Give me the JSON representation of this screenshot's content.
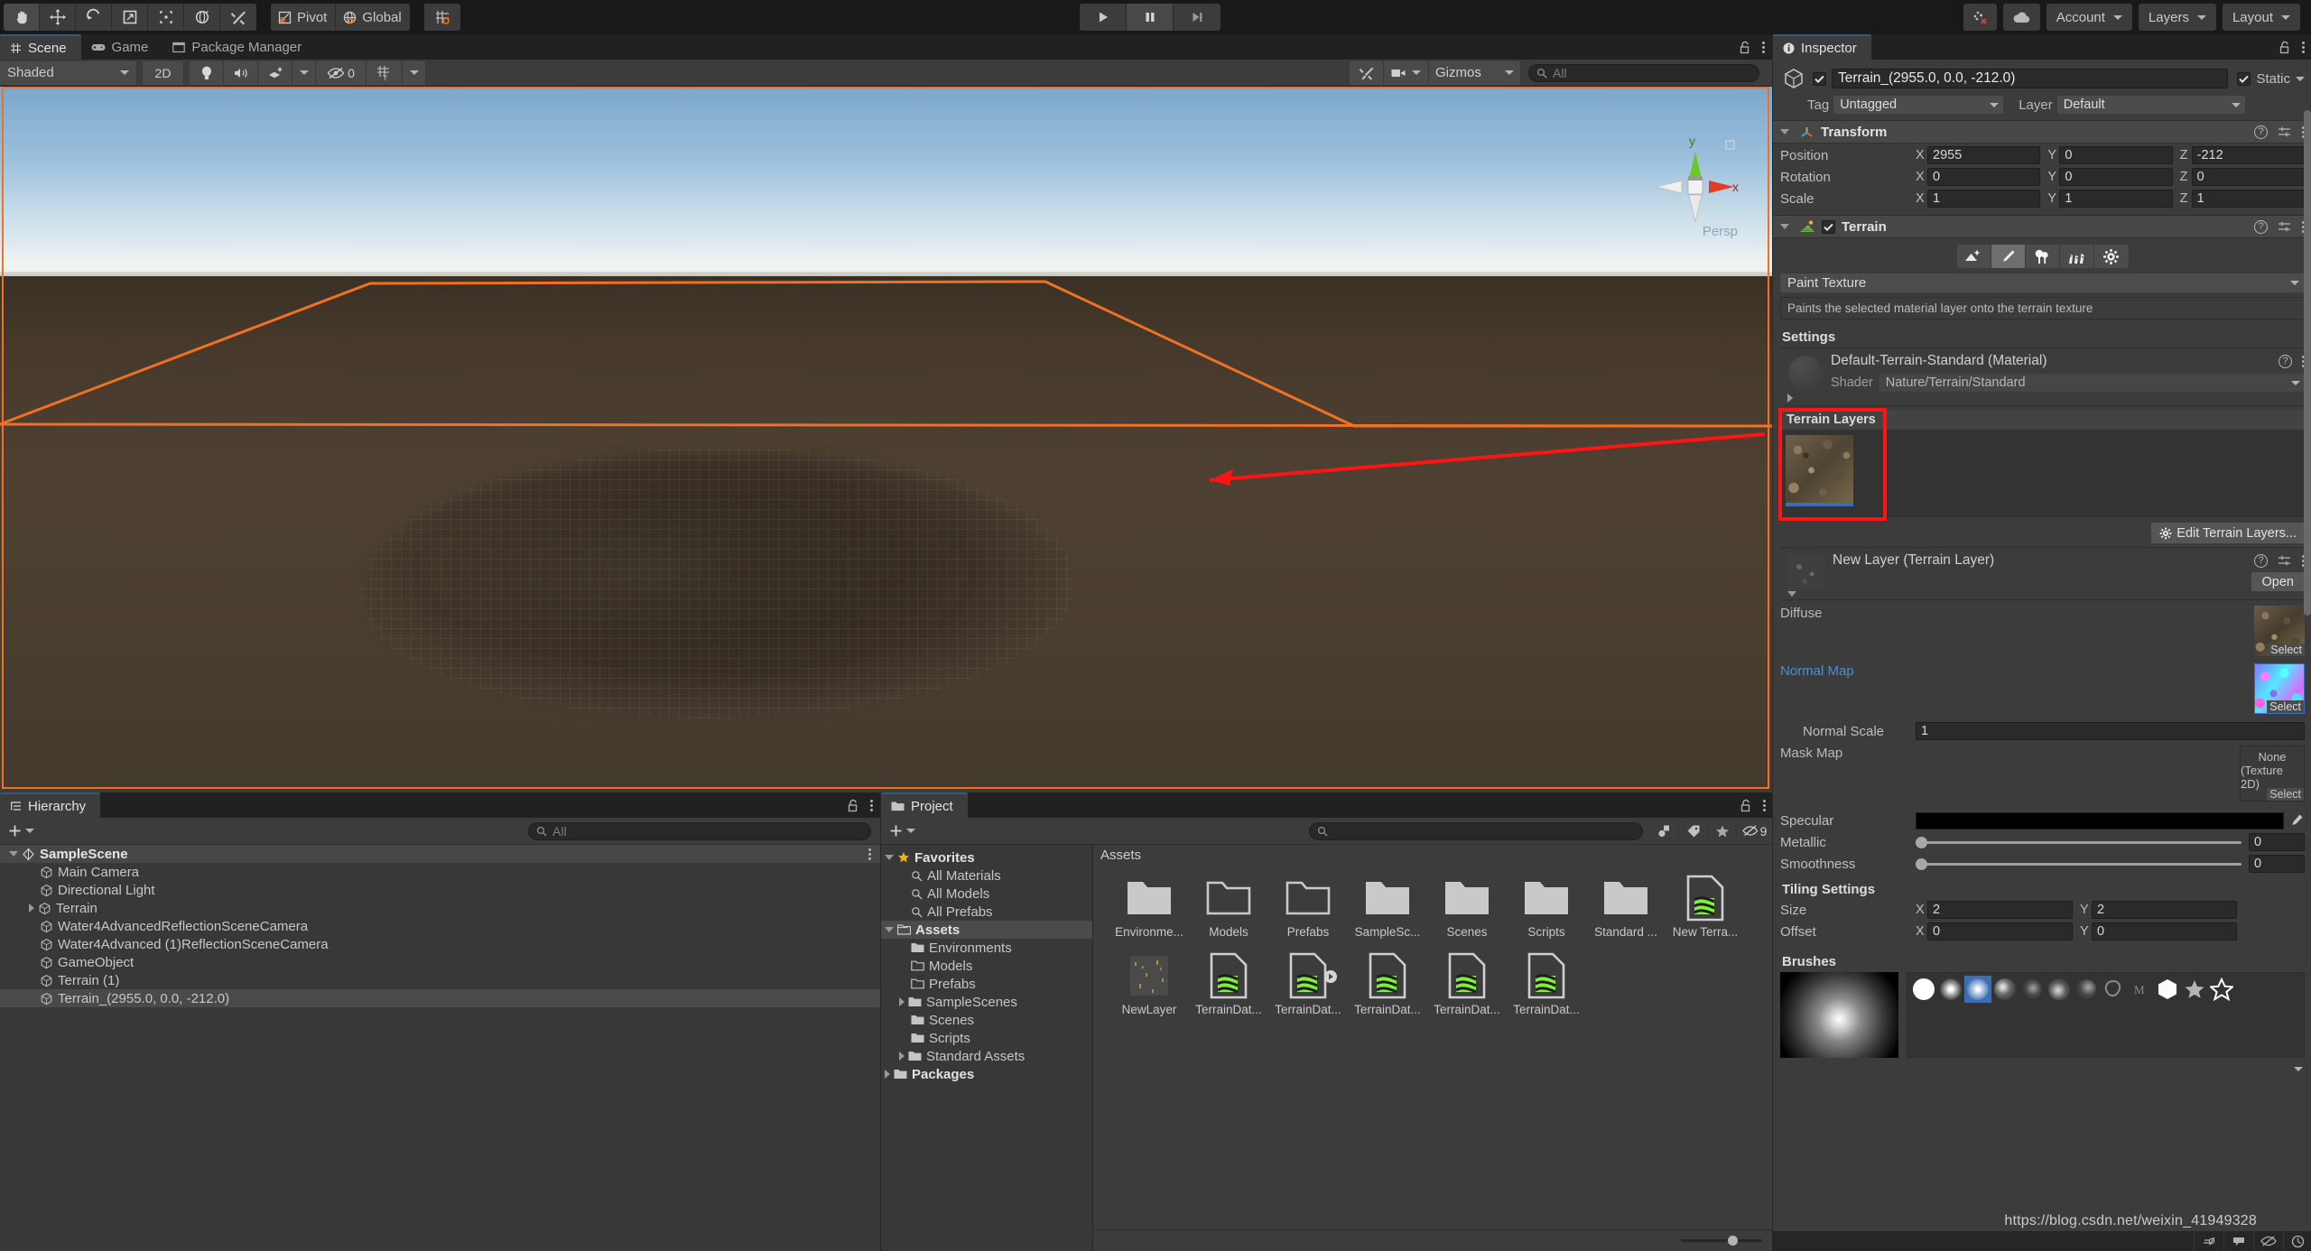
{
  "toolbar": {
    "tools": [
      {
        "name": "hand-tool-icon",
        "label": "Hand"
      },
      {
        "name": "move-tool-icon",
        "label": "Move"
      },
      {
        "name": "rotate-tool-icon",
        "label": "Rotate"
      },
      {
        "name": "scale-tool-icon",
        "label": "Scale"
      },
      {
        "name": "rect-transform-tool-icon",
        "label": "Rect Transform"
      },
      {
        "name": "transform-tool-icon",
        "label": "Transform"
      },
      {
        "name": "custom-editor-tool-icon",
        "label": "Custom Tool"
      }
    ],
    "pivot_label": "Pivot",
    "global_label": "Global",
    "snap_label": "",
    "play_label": "Play",
    "pause_label": "Pause",
    "step_label": "Step",
    "collab_label": "",
    "cloud_label": "",
    "account_label": "Account",
    "layers_label": "Layers",
    "layout_label": "Layout"
  },
  "scene": {
    "tabs": [
      {
        "label": "Scene",
        "icon": "grid-icon",
        "active": true
      },
      {
        "label": "Game",
        "icon": "gamepad-icon",
        "active": false
      },
      {
        "label": "Package Manager",
        "icon": "package-icon",
        "active": false
      }
    ],
    "draw_mode": "Shaded",
    "mode_2d": "2D",
    "hidden_count": "0",
    "gizmos_label": "Gizmos",
    "search_placeholder": "All",
    "gizmo_axes": {
      "x": "x",
      "y": "y"
    },
    "perspective_label": "Persp"
  },
  "hierarchy": {
    "tabs": [
      {
        "label": "Hierarchy",
        "icon": "hierarchy-icon",
        "active": true
      }
    ],
    "search_placeholder": "All",
    "items": [
      {
        "label": "SampleScene",
        "depth": 0,
        "type": "scene",
        "expanded": true,
        "selected": false
      },
      {
        "label": "Main Camera",
        "depth": 1,
        "type": "object",
        "expanded": null,
        "selected": false
      },
      {
        "label": "Directional Light",
        "depth": 1,
        "type": "object",
        "expanded": null,
        "selected": false
      },
      {
        "label": "Terrain",
        "depth": 1,
        "type": "object",
        "expanded": false,
        "selected": false
      },
      {
        "label": "Water4AdvancedReflectionSceneCamera",
        "depth": 1,
        "type": "object",
        "expanded": null,
        "selected": false
      },
      {
        "label": "Water4Advanced (1)ReflectionSceneCamera",
        "depth": 1,
        "type": "object",
        "expanded": null,
        "selected": false
      },
      {
        "label": "GameObject",
        "depth": 1,
        "type": "object",
        "expanded": null,
        "selected": false
      },
      {
        "label": "Terrain (1)",
        "depth": 1,
        "type": "object",
        "expanded": null,
        "selected": false
      },
      {
        "label": "Terrain_(2955.0, 0.0, -212.0)",
        "depth": 1,
        "type": "object",
        "expanded": null,
        "selected": true
      }
    ]
  },
  "project": {
    "tabs": [
      {
        "label": "Project",
        "icon": "folder-icon",
        "active": true
      }
    ],
    "search_placeholder": "",
    "hidden_count": "9",
    "breadcrumb": "Assets",
    "tree": [
      {
        "label": "Favorites",
        "depth": 0,
        "icon": "star-icon",
        "expanded": true,
        "bold": true,
        "selected": false
      },
      {
        "label": "All Materials",
        "depth": 1,
        "icon": "search-icon",
        "expanded": null,
        "bold": false,
        "selected": false
      },
      {
        "label": "All Models",
        "depth": 1,
        "icon": "search-icon",
        "expanded": null,
        "bold": false,
        "selected": false
      },
      {
        "label": "All Prefabs",
        "depth": 1,
        "icon": "search-icon",
        "expanded": null,
        "bold": false,
        "selected": false
      },
      {
        "label": "Assets",
        "depth": 0,
        "icon": "folder-open-icon",
        "expanded": true,
        "bold": true,
        "selected": true
      },
      {
        "label": "Environments",
        "depth": 1,
        "icon": "folder-icon",
        "expanded": null,
        "bold": false,
        "selected": false
      },
      {
        "label": "Models",
        "depth": 1,
        "icon": "folder-empty-icon",
        "expanded": null,
        "bold": false,
        "selected": false
      },
      {
        "label": "Prefabs",
        "depth": 1,
        "icon": "folder-empty-icon",
        "expanded": null,
        "bold": false,
        "selected": false
      },
      {
        "label": "SampleScenes",
        "depth": 1,
        "icon": "folder-icon",
        "expanded": false,
        "bold": false,
        "selected": false
      },
      {
        "label": "Scenes",
        "depth": 1,
        "icon": "folder-icon",
        "expanded": null,
        "bold": false,
        "selected": false
      },
      {
        "label": "Scripts",
        "depth": 1,
        "icon": "folder-icon",
        "expanded": null,
        "bold": false,
        "selected": false
      },
      {
        "label": "Standard Assets",
        "depth": 1,
        "icon": "folder-icon",
        "expanded": false,
        "bold": false,
        "selected": false
      },
      {
        "label": "Packages",
        "depth": 0,
        "icon": "folder-icon",
        "expanded": false,
        "bold": true,
        "selected": false
      }
    ],
    "assets": [
      {
        "label": "Environme...",
        "kind": "folder"
      },
      {
        "label": "Models",
        "kind": "folder-empty"
      },
      {
        "label": "Prefabs",
        "kind": "folder-empty"
      },
      {
        "label": "SampleSc...",
        "kind": "folder"
      },
      {
        "label": "Scenes",
        "kind": "folder"
      },
      {
        "label": "Scripts",
        "kind": "folder"
      },
      {
        "label": "Standard ...",
        "kind": "folder"
      },
      {
        "label": "New Terra...",
        "kind": "terrain-asset"
      },
      {
        "label": "NewLayer",
        "kind": "texture-asset"
      },
      {
        "label": "TerrainDat...",
        "kind": "terrain-asset"
      },
      {
        "label": "TerrainDat...",
        "kind": "terrain-asset-expandable"
      },
      {
        "label": "TerrainDat...",
        "kind": "terrain-asset"
      },
      {
        "label": "TerrainDat...",
        "kind": "terrain-asset"
      },
      {
        "label": "TerrainDat...",
        "kind": "terrain-asset"
      }
    ]
  },
  "inspector": {
    "tabs": [
      {
        "label": "Inspector",
        "icon": "info-icon",
        "active": true
      }
    ],
    "object": {
      "name": "Terrain_(2955.0, 0.0, -212.0)",
      "enabled": true,
      "static_label": "Static",
      "static_checked": true,
      "tag_label": "Tag",
      "tag_value": "Untagged",
      "layer_label": "Layer",
      "layer_value": "Default"
    },
    "transform": {
      "title": "Transform",
      "rows": [
        {
          "label": "Position",
          "x": "2955",
          "y": "0",
          "z": "-212"
        },
        {
          "label": "Rotation",
          "x": "0",
          "y": "0",
          "z": "0"
        },
        {
          "label": "Scale",
          "x": "1",
          "y": "1",
          "z": "1"
        }
      ]
    },
    "terrain": {
      "title": "Terrain",
      "enabled": true,
      "tool_tabs": [
        {
          "name": "terrain-raise-lower-icon",
          "selected": false
        },
        {
          "name": "terrain-paint-icon",
          "selected": true
        },
        {
          "name": "terrain-trees-icon",
          "selected": false
        },
        {
          "name": "terrain-details-icon",
          "selected": false
        },
        {
          "name": "terrain-settings-icon",
          "selected": false
        }
      ],
      "tool_mode": "Paint Texture",
      "tool_help": "Paints the selected material layer onto the terrain texture",
      "settings_title": "Settings",
      "material_name": "Default-Terrain-Standard (Material)",
      "shader_label": "Shader",
      "shader_value": "Nature/Terrain/Standard",
      "terrain_layers_title": "Terrain Layers",
      "edit_terrain_layers_label": "Edit Terrain Layers...",
      "layer_asset_name": "New Layer (Terrain Layer)",
      "open_label": "Open",
      "diffuse_label": "Diffuse",
      "diffuse_select_label": "Select",
      "normal_map_label": "Normal Map",
      "normal_select_label": "Select",
      "normal_scale_label": "Normal Scale",
      "normal_scale_value": "1",
      "mask_map_label": "Mask Map",
      "mask_map_value_line1": "None",
      "mask_map_value_line2": "(Texture 2D)",
      "mask_select_label": "Select",
      "specular_label": "Specular",
      "specular_color": "#000000",
      "metallic_label": "Metallic",
      "metallic_value": "0",
      "smoothness_label": "Smoothness",
      "smoothness_value": "0",
      "tiling_title": "Tiling Settings",
      "size_label": "Size",
      "size_x": "2",
      "size_y": "2",
      "offset_label": "Offset",
      "offset_x": "0",
      "offset_y": "0",
      "brushes_title": "Brushes",
      "brush_count": 11,
      "brush_selected_index": 2
    }
  },
  "colors": {
    "accent": "#3c6eb4",
    "selection_outline": "#f07122",
    "highlight_box": "#ff1414",
    "panel_bg": "#3c3c3c",
    "toolbar_bg": "#191919"
  },
  "watermark": "https://blog.csdn.net/weixin_41949328"
}
